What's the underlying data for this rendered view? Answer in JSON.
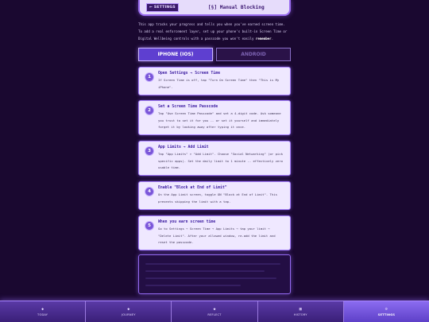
{
  "header": {
    "back_label": "← SETTINGS",
    "title": "[§] Manual Blocking"
  },
  "intro": {
    "text_before": "This app tracks your progress and tells you when you've earned screen time. To add a real enforcement layer, set up your phone's built-in Screen Time or Digital Wellbeing controls with a passcode you won't easily ",
    "emphasis": "remember",
    "text_after": "."
  },
  "platform_toggle": {
    "options": [
      {
        "label": "IPHONE (IOS)",
        "selected": true
      },
      {
        "label": "ANDROID",
        "selected": false
      }
    ]
  },
  "steps": [
    {
      "number": "1",
      "title": "Open Settings → Screen Time",
      "body": "If Screen Time is off, tap \"Turn On Screen Time\" then \"This is My iPhone\"."
    },
    {
      "number": "2",
      "title": "Set a Screen Time Passcode",
      "body": "Tap \"Use Screen Time Passcode\" and set a 4-digit code. Ask someone you trust to set it for you -- or set it yourself and immediately forget it by looking away after typing it once."
    },
    {
      "number": "3",
      "title": "App Limits → Add Limit",
      "body": "Tap \"App Limits\" > \"Add Limit\". Choose \"Social Networking\" (or pick specific apps). Set the daily limit to 1 minute -- effectively zero usable time."
    },
    {
      "number": "4",
      "title": "Enable \"Block at End of Limit\"",
      "body": "On the App Limit screen, toggle ON \"Block at End of Limit\". This prevents skipping the limit with a tap."
    },
    {
      "number": "5",
      "title": "When you earn screen time",
      "body": "Go to Settings → Screen Time → App Limits → tap your limit → \"Delete Limit\". After your allowed window, re-add the limit and reset the passcode."
    }
  ],
  "nav": {
    "items": [
      {
        "label": "TODAY",
        "icon": "◆",
        "active": false
      },
      {
        "label": "JOURNEY",
        "icon": "◆",
        "active": false
      },
      {
        "label": "REFLECT",
        "icon": "◆",
        "active": false
      },
      {
        "label": "HISTORY",
        "icon": "▦",
        "active": false
      },
      {
        "label": "SETTINGS",
        "icon": "⚙",
        "active": true
      }
    ]
  },
  "colors": {
    "background": "#1a0830",
    "accent": "#9a6cf0",
    "card": "#efe8ff",
    "title_text": "#3b1ba0"
  }
}
